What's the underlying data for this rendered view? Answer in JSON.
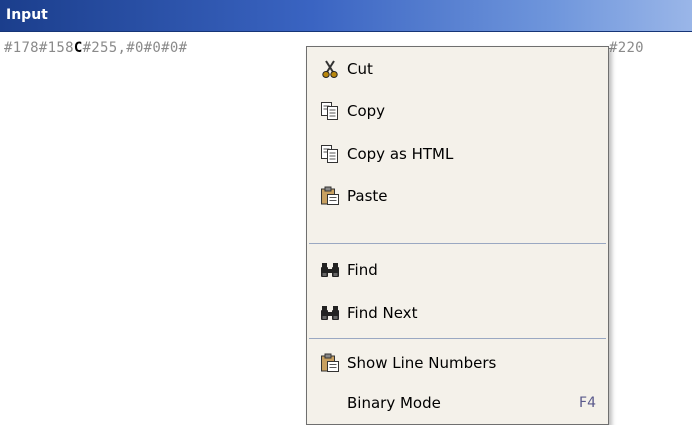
{
  "window": {
    "title": "Input"
  },
  "content": {
    "prefix": "#178#158",
    "highlight": "C",
    "suffix": "#255,#0#0#0#",
    "overflow_tail": "#220"
  },
  "context_menu": {
    "items": [
      {
        "label": "Cut",
        "icon": "scissors-icon"
      },
      {
        "label": "Copy",
        "icon": "copy-icon"
      },
      {
        "label": "Copy as HTML",
        "icon": "copy-icon"
      },
      {
        "label": "Paste",
        "icon": "paste-icon"
      },
      {
        "label": "Find",
        "icon": "binoculars-icon"
      },
      {
        "label": "Find Next",
        "icon": "binoculars-icon"
      },
      {
        "label": "Show Line Numbers",
        "icon": "paste-icon"
      },
      {
        "label": "Binary Mode",
        "icon": "",
        "shortcut": "F4"
      }
    ]
  },
  "colors": {
    "titlebar_start": "#1b3e8c",
    "titlebar_end": "#9ab6e8",
    "menu_bg": "#f4f1ea",
    "separator": "#9aa8c2"
  }
}
